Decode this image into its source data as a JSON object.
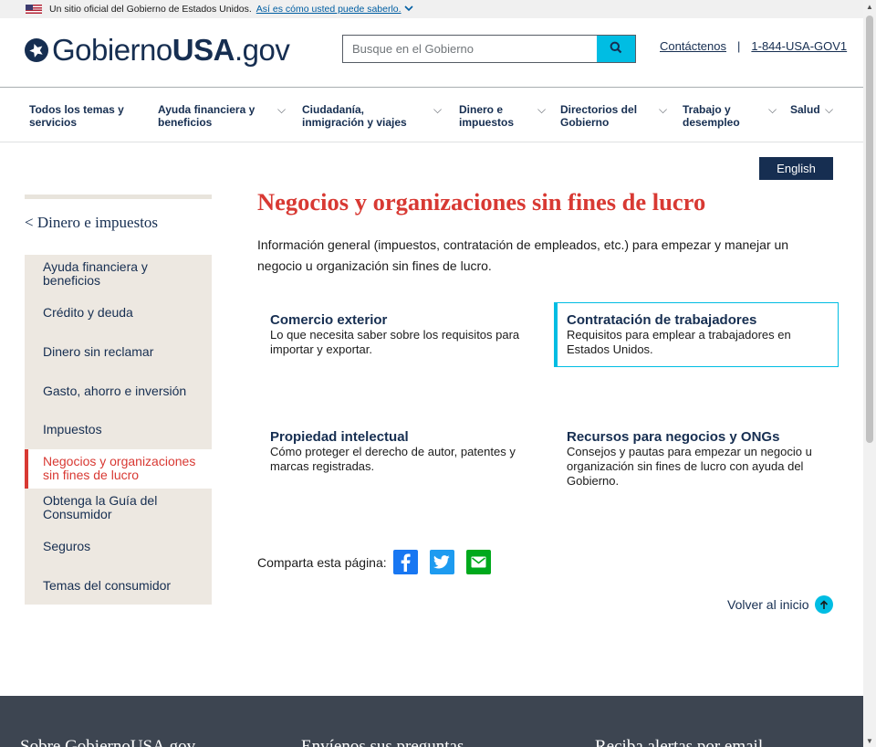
{
  "banner": {
    "text": "Un sitio oficial del Gobierno de Estados Unidos.",
    "link": "Así es cómo usted puede saberlo."
  },
  "header": {
    "logo_regular": "Gobierno",
    "logo_bold": "USA",
    "logo_suffix": ".gov",
    "search_placeholder": "Busque en el Gobierno",
    "contact_link": "Contáctenos",
    "separator": "|",
    "phone_link": "1-844-USA-GOV1"
  },
  "nav": {
    "items": [
      {
        "line1": "Todos los temas y",
        "line2": "servicios"
      },
      {
        "line1": "Ayuda financiera y",
        "line2": "beneficios"
      },
      {
        "line1": "Ciudadanía,",
        "line2": "inmigración y viajes"
      },
      {
        "line1": "Dinero e",
        "line2": "impuestos"
      },
      {
        "line1": "Directorios del",
        "line2": "Gobierno"
      },
      {
        "line1": "Trabajo y",
        "line2": "desempleo"
      },
      {
        "line1": "Salud",
        "line2": ""
      }
    ]
  },
  "language_button": "English",
  "sidebar": {
    "back_link": "< Dinero e impuestos",
    "items": [
      {
        "label": "Ayuda financiera y beneficios"
      },
      {
        "label": "Crédito y deuda"
      },
      {
        "label": "Dinero sin reclamar"
      },
      {
        "label": "Gasto, ahorro e inversión"
      },
      {
        "label": "Impuestos"
      },
      {
        "label": "Negocios y organizaciones sin fines de lucro"
      },
      {
        "label": "Obtenga la Guía del Consumidor"
      },
      {
        "label": "Seguros"
      },
      {
        "label": "Temas del consumidor"
      }
    ]
  },
  "main": {
    "title": "Negocios y organizaciones sin fines de lucro",
    "intro": "Información general (impuestos, contratación de empleados, etc.) para empezar y manejar un negocio u organización sin fines de lucro.",
    "cards": [
      {
        "title": "Comercio exterior",
        "desc": "Lo que necesita saber sobre los requisitos para importar y exportar."
      },
      {
        "title": "Contratación de trabajadores",
        "desc": "Requisitos para emplear a trabajadores en Estados Unidos."
      },
      {
        "title": "Propiedad intelectual",
        "desc": "Cómo proteger el derecho de autor, patentes y marcas registradas."
      },
      {
        "title": "Recursos para negocios y ONGs",
        "desc": "Consejos y pautas para empezar un negocio u organización sin fines de lucro con ayuda del Gobierno."
      }
    ],
    "share_label": "Comparta esta página:",
    "back_to_top": "Volver al inicio"
  },
  "footer": {
    "headings": [
      "Sobre GobiernoUSA.gov",
      "Envíenos sus preguntas",
      "Reciba alertas por email"
    ]
  },
  "colors": {
    "navy": "#162e51",
    "accent_red": "#d83933",
    "accent_cyan": "#00bde3",
    "sidebar_bg": "#ede8e1",
    "footer_bg": "#3d4551"
  }
}
